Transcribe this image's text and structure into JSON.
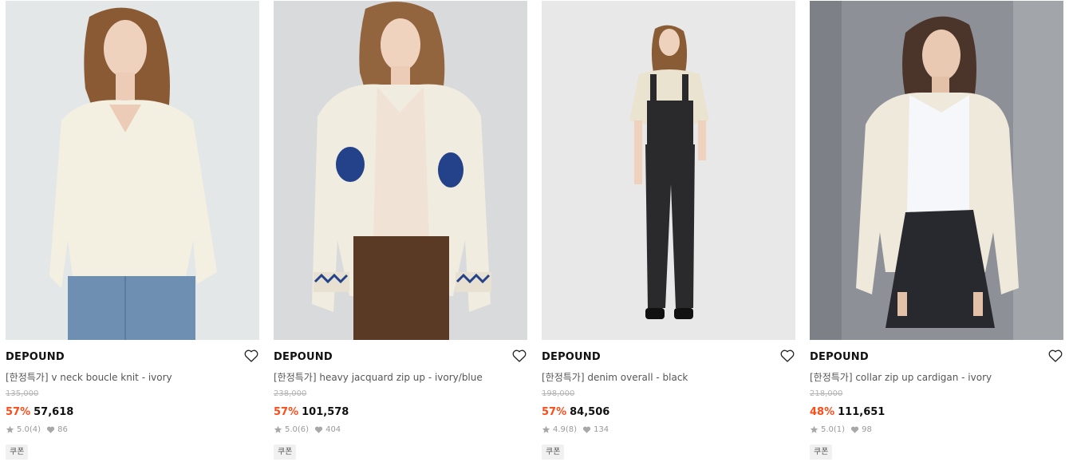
{
  "products": [
    {
      "brand": "DEPOUND",
      "name": "[한정특가] v neck boucle knit - ivory",
      "original_price": "135,000",
      "discount": "57%",
      "price": "57,618",
      "rating": "5.0",
      "reviews": "(4)",
      "likes": "86",
      "coupon": "쿠폰",
      "photo_colors": {
        "bg": "#dcdfe0",
        "top": "#f3f0e2",
        "bottom": "#6f8fb2",
        "hair": "#8a5a34"
      }
    },
    {
      "brand": "DEPOUND",
      "name": "[한정특가] heavy jacquard zip up - ivory/blue",
      "original_price": "238,000",
      "discount": "57%",
      "price": "101,578",
      "rating": "5.0",
      "reviews": "(6)",
      "likes": "404",
      "coupon": "쿠폰",
      "photo_colors": {
        "bg": "#d9dadb",
        "top": "#f1ece0",
        "bottom": "#5a3a24",
        "hair": "#93653f"
      }
    },
    {
      "brand": "DEPOUND",
      "name": "[한정특가] denim overall - black",
      "original_price": "198,000",
      "discount": "57%",
      "price": "84,506",
      "rating": "4.9",
      "reviews": "(8)",
      "likes": "134",
      "coupon": "쿠폰",
      "photo_colors": {
        "bg": "#e8e8e8",
        "top": "#eae3cf",
        "bottom": "#2a2a2c",
        "hair": "#8a5c36"
      }
    },
    {
      "brand": "DEPOUND",
      "name": "[한정특가] collar zip up cardigan - ivory",
      "original_price": "218,000",
      "discount": "48%",
      "price": "111,651",
      "rating": "5.0",
      "reviews": "(1)",
      "likes": "98",
      "coupon": "쿠폰",
      "photo_colors": {
        "bg": "#8d9096",
        "top": "#efe9dc",
        "bottom": "#27292e",
        "hair": "#4b352a"
      }
    }
  ],
  "colors": {
    "discount": "#ff4b17",
    "text": "#111111",
    "muted": "#999999"
  },
  "icons": {
    "wishlist": "heart-outline-icon",
    "rating": "star-icon",
    "likes": "heart-filled-icon"
  }
}
